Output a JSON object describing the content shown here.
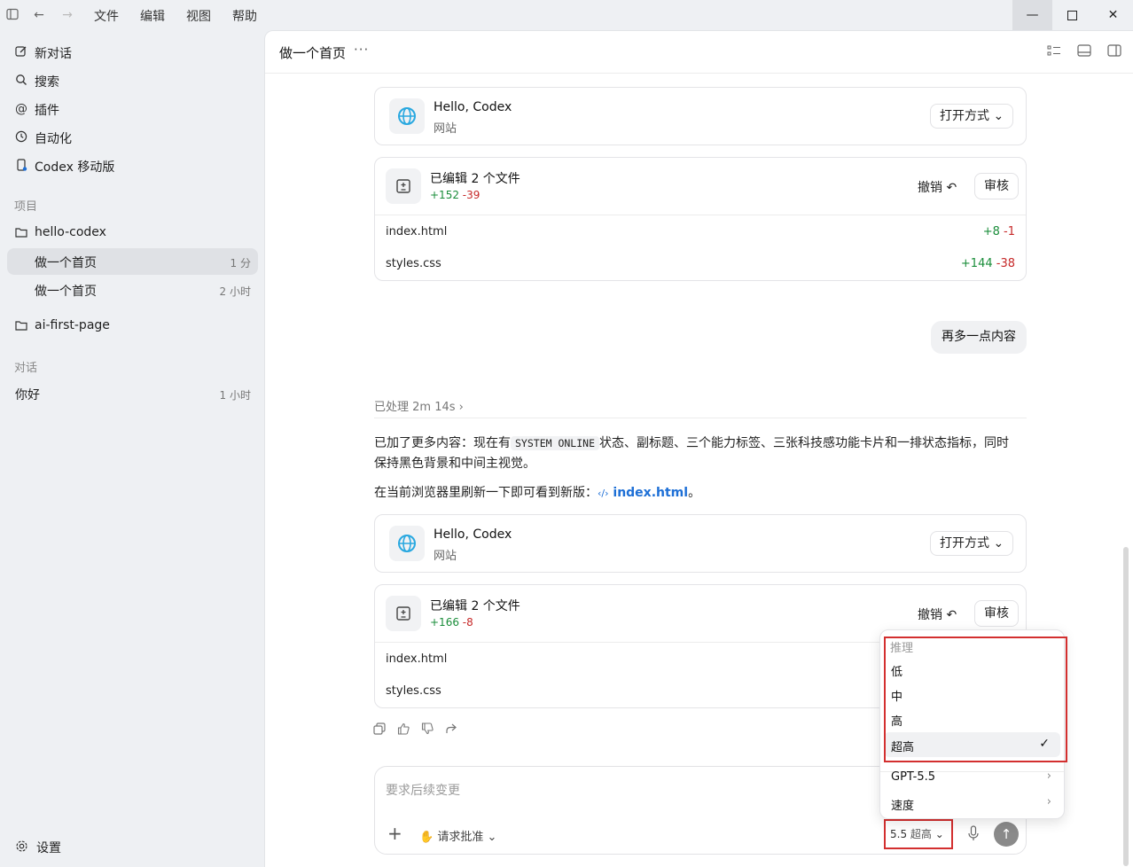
{
  "menubar": {
    "file": "文件",
    "edit": "编辑",
    "view": "视图",
    "help": "帮助"
  },
  "sidebar": {
    "top": [
      {
        "label": "新对话",
        "icon": "new-chat-icon"
      },
      {
        "label": "搜索",
        "icon": "search-icon"
      },
      {
        "label": "插件",
        "icon": "at-icon"
      },
      {
        "label": "自动化",
        "icon": "clock-icon"
      },
      {
        "label": "Codex 移动版",
        "icon": "mobile-icon"
      }
    ],
    "projects_heading": "项目",
    "projects": [
      {
        "label": "hello-codex"
      },
      {
        "label": "ai-first-page"
      }
    ],
    "threads": [
      {
        "label": "做一个首页",
        "time": "1 分"
      },
      {
        "label": "做一个首页",
        "time": "2 小时"
      }
    ],
    "chats_heading": "对话",
    "chats": [
      {
        "label": "你好",
        "time": "1 小时"
      }
    ],
    "settings": "设置"
  },
  "main": {
    "title": "做一个首页",
    "more": "···",
    "site_card_1": {
      "title": "Hello, Codex",
      "subtitle": "网站",
      "open_with": "打开方式"
    },
    "edit_card_1": {
      "title": "已编辑 2 个文件",
      "added": "+152",
      "removed": "-39",
      "undo": "撤销",
      "review": "审核",
      "files": [
        {
          "name": "index.html",
          "added": "+8",
          "removed": "-1"
        },
        {
          "name": "styles.css",
          "added": "+144",
          "removed": "-38"
        }
      ]
    },
    "user_message": "再多一点内容",
    "processed": "已处理 2m 14s",
    "reply_1a": "已加了更多内容：现在有",
    "reply_code": "SYSTEM ONLINE",
    "reply_1b": "状态、副标题、三个能力标签、三张科技感功能卡片和一排状态指标，同时",
    "reply_1c": "保持黑色背景和中间主视觉。",
    "reply_2a": "在当前浏览器里刷新一下即可看到新版：",
    "reply_link": "index.html",
    "reply_2b": "。",
    "site_card_2": {
      "title": "Hello, Codex",
      "subtitle": "网站",
      "open_with": "打开方式"
    },
    "edit_card_2": {
      "title": "已编辑 2 个文件",
      "added": "+166",
      "removed": "-8",
      "undo": "撤销",
      "review": "审核",
      "files": [
        {
          "name": "index.html"
        },
        {
          "name": "styles.css"
        }
      ]
    }
  },
  "composer": {
    "placeholder": "要求后续变更",
    "approval": "请求批准",
    "model": "5.5",
    "reasoning": "超高"
  },
  "dropdown": {
    "section": "推理",
    "items": [
      {
        "label": "低"
      },
      {
        "label": "中"
      },
      {
        "label": "高"
      },
      {
        "label": "超高",
        "selected": true
      }
    ],
    "model_item": "GPT-5.5",
    "speed_item": "速度",
    "check": "✓"
  },
  "colors": {
    "added": "#1a8d3a",
    "removed": "#c62828",
    "link": "#1d6fd6",
    "highlight": "#d32f2f"
  }
}
